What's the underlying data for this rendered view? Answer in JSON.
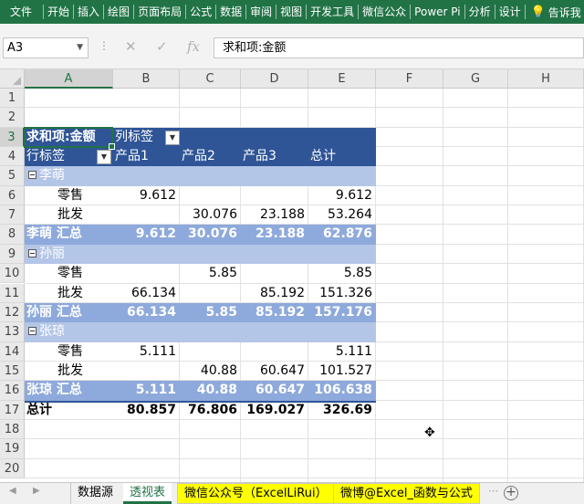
{
  "ribbon": {
    "tabs": [
      "文件",
      "开始",
      "插入",
      "绘图",
      "页面布局",
      "公式",
      "数据",
      "审阅",
      "视图",
      "开发工具",
      "微信公众",
      "Power Pi",
      "分析",
      "设计"
    ],
    "tell_me": "告诉我"
  },
  "formula_bar": {
    "name_box": "A3",
    "formula": "求和项:金额",
    "fx": "fx"
  },
  "columns": [
    "A",
    "B",
    "C",
    "D",
    "E",
    "F",
    "G",
    "H"
  ],
  "rows": [
    "1",
    "2",
    "3",
    "4",
    "5",
    "6",
    "7",
    "8",
    "9",
    "10",
    "11",
    "12",
    "13",
    "14",
    "15",
    "16",
    "17",
    "18",
    "19",
    "20"
  ],
  "pivot": {
    "value_field": "求和项:金额",
    "col_labels": "列标签",
    "row_labels": "行标签",
    "headers": [
      "产品1",
      "产品2",
      "产品3",
      "总计"
    ],
    "groups": [
      {
        "name": "李萌",
        "rows": [
          {
            "label": "零售",
            "values": [
              "9.612",
              "",
              "",
              "9.612"
            ]
          },
          {
            "label": "批发",
            "values": [
              "",
              "30.076",
              "23.188",
              "53.264"
            ]
          }
        ],
        "subtotal_label": "李萌 汇总",
        "subtotal": [
          "9.612",
          "30.076",
          "23.188",
          "62.876"
        ]
      },
      {
        "name": "孙丽",
        "rows": [
          {
            "label": "零售",
            "values": [
              "",
              "5.85",
              "",
              "5.85"
            ]
          },
          {
            "label": "批发",
            "values": [
              "66.134",
              "",
              "85.192",
              "151.326"
            ]
          }
        ],
        "subtotal_label": "孙丽 汇总",
        "subtotal": [
          "66.134",
          "5.85",
          "85.192",
          "157.176"
        ]
      },
      {
        "name": "张琼",
        "rows": [
          {
            "label": "零售",
            "values": [
              "5.111",
              "",
              "",
              "5.111"
            ]
          },
          {
            "label": "批发",
            "values": [
              "",
              "40.88",
              "60.647",
              "101.527"
            ]
          }
        ],
        "subtotal_label": "张琼 汇总",
        "subtotal": [
          "5.111",
          "40.88",
          "60.647",
          "106.638"
        ]
      }
    ],
    "grand_total_label": "总计",
    "grand_total": [
      "80.857",
      "76.806",
      "169.027",
      "326.69"
    ]
  },
  "sheet_tabs": [
    {
      "label": "数据源",
      "active": false
    },
    {
      "label": "透视表",
      "active": true
    },
    {
      "label": "微信公众号（ExcelLiRui）",
      "active": false,
      "highlight": "#ffff00"
    },
    {
      "label": "微博@Excel_函数与公式",
      "active": false,
      "highlight": "#ffff00"
    }
  ],
  "colors": {
    "accent": "#217346",
    "pivot_header": "#2f5597",
    "pivot_group": "#b4c6e7",
    "pivot_subtotal": "#8ea9db"
  }
}
